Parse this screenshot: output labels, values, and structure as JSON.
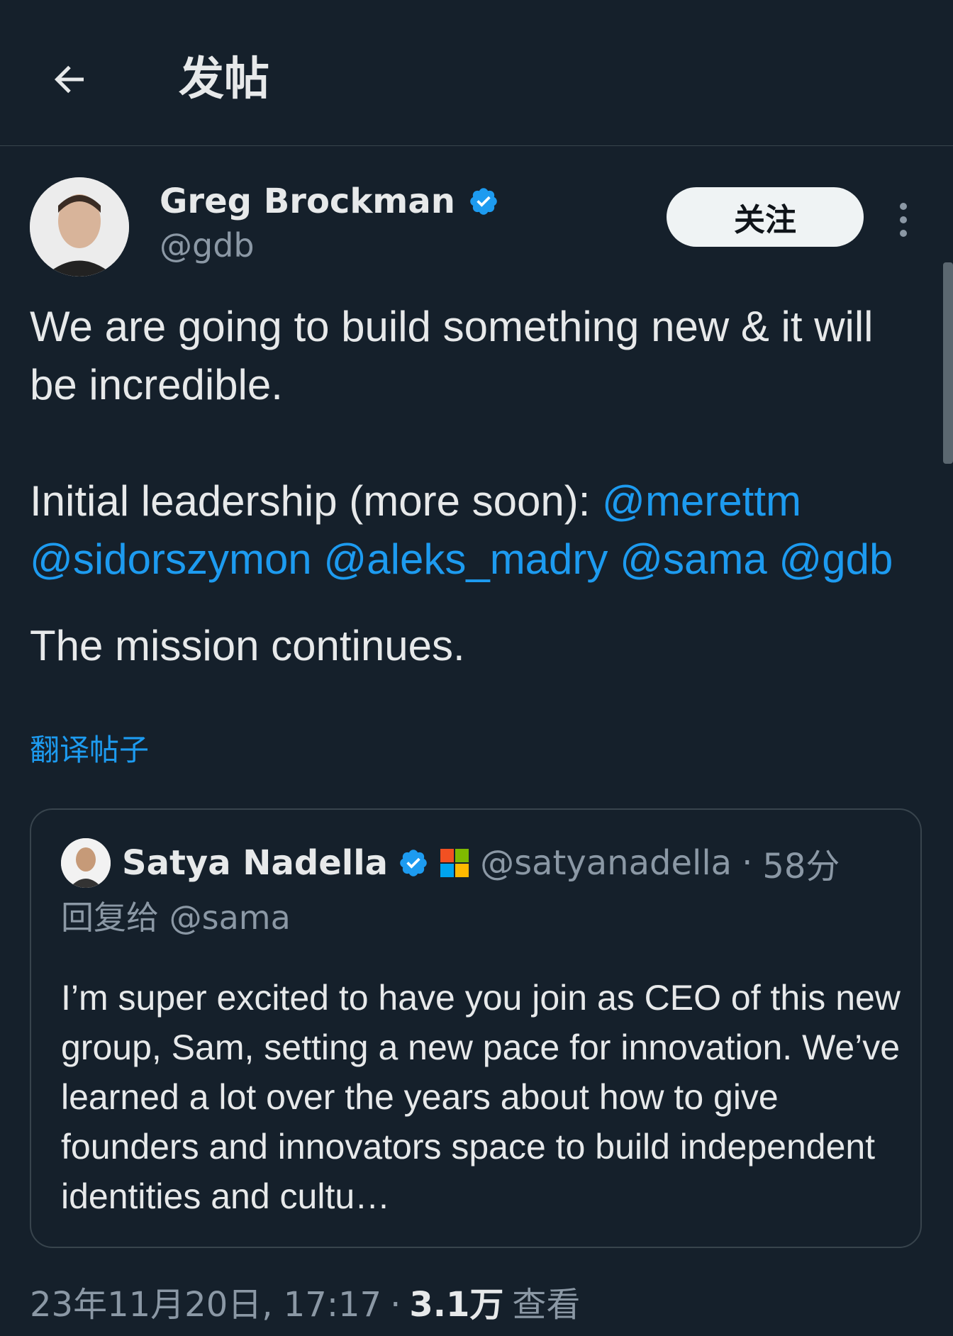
{
  "header": {
    "title": "发帖"
  },
  "post": {
    "author_name": "Greg Brockman",
    "author_handle": "@gdb",
    "follow_label": "关注",
    "line1": "We are going to build something new & it will be incredible.",
    "line2_prefix": "Initial leadership (more soon): ",
    "mentions": [
      "@merettm",
      "@sidorszymon",
      "@aleks_madry",
      "@sama",
      "@gdb"
    ],
    "line3": "The mission continues.",
    "translate_label": "翻译帖子"
  },
  "quote": {
    "author_name": "Satya Nadella",
    "author_handle": "@satyanadella",
    "separator": "·",
    "time": "58分",
    "reply_prefix": "回复给",
    "reply_to": "@sama",
    "text": "I’m super excited to have you join as CEO of this new group, Sam, setting a new pace for innovation. We’ve learned a lot over the years about how to give founders and innovators space to build independent identities and cultu…"
  },
  "meta": {
    "timestamp": "23年11月20日, 17:17",
    "separator": "·",
    "views_count": "3.1万",
    "views_label": "查看"
  },
  "colors": {
    "background": "#15202b",
    "accent": "#1d9bf0",
    "muted": "#8b98a5"
  }
}
